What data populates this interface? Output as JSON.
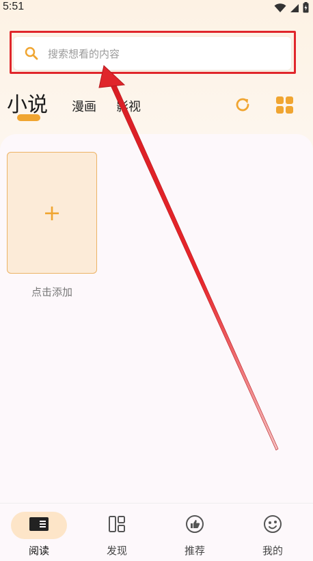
{
  "status_bar": {
    "time": "5:51",
    "icons": [
      "wifi-icon",
      "signal-icon",
      "battery-icon"
    ]
  },
  "search": {
    "placeholder": "搜索想看的内容",
    "icon": "search-icon"
  },
  "tabs": [
    {
      "label": "小说",
      "active": true
    },
    {
      "label": "漫画",
      "active": false
    },
    {
      "label": "影视",
      "active": false
    }
  ],
  "toolbar": {
    "refresh_icon": "refresh-icon",
    "grid_icon": "grid-view-icon"
  },
  "bookshelf": {
    "add_card_symbol": "+",
    "add_label": "点击添加"
  },
  "bottom_nav": [
    {
      "label": "阅读",
      "icon": "book-reader-icon",
      "active": true
    },
    {
      "label": "发现",
      "icon": "layout-icon",
      "active": false
    },
    {
      "label": "推荐",
      "icon": "thumbs-up-icon",
      "active": false
    },
    {
      "label": "我的",
      "icon": "profile-face-icon",
      "active": false
    }
  ],
  "colors": {
    "accent": "#f0a531",
    "annotation": "#e0262b",
    "background": "#fdf8fb"
  }
}
